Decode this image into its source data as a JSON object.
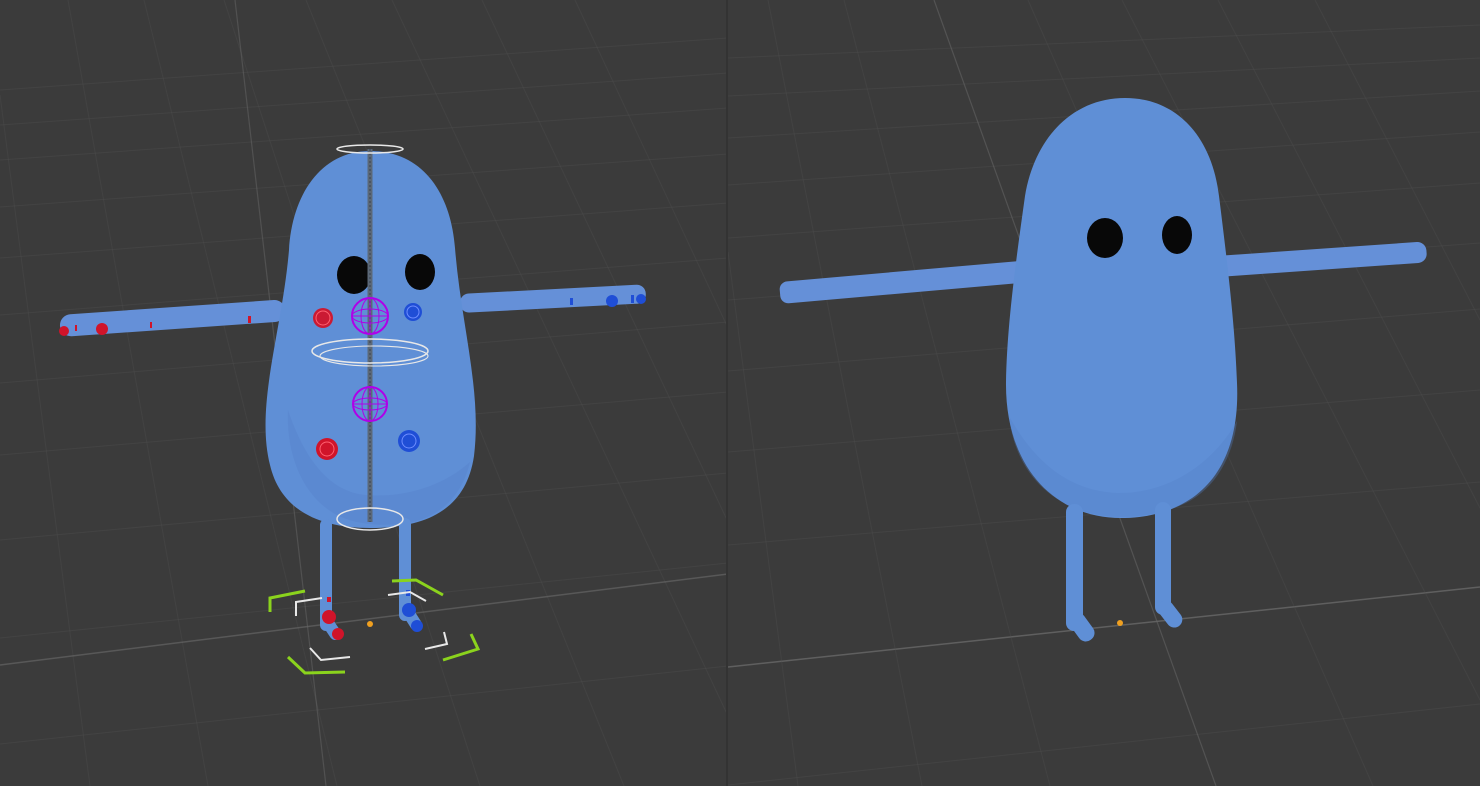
{
  "colors": {
    "viewport_background": "#3b3b3b",
    "grid_line": "#4a4a4a",
    "grid_line_dark": "#343434",
    "body_blue": "#5f8fd6",
    "body_shadow": "#4f7fc6",
    "eye_black": "#080808",
    "rig_red": "#d0142a",
    "rig_blue": "#1f4ed6",
    "rig_purple": "#b000e8",
    "rig_white": "#e8e8e8",
    "rig_green": "#8bd31d",
    "origin_orange": "#f0a020"
  },
  "viewports": [
    {
      "name": "rig-edit-viewport",
      "mode": "armature-controls-visible",
      "character": "blue-blob-with-rig-controls"
    },
    {
      "name": "object-preview-viewport",
      "mode": "mesh-only",
      "character": "blue-blob-character"
    }
  ],
  "icons": {
    "origin": "origin-dot-icon",
    "bone_chain": "bone-chain-icon",
    "ik_control": "ik-control-icon",
    "custom_shape": "custom-shape-icon"
  }
}
